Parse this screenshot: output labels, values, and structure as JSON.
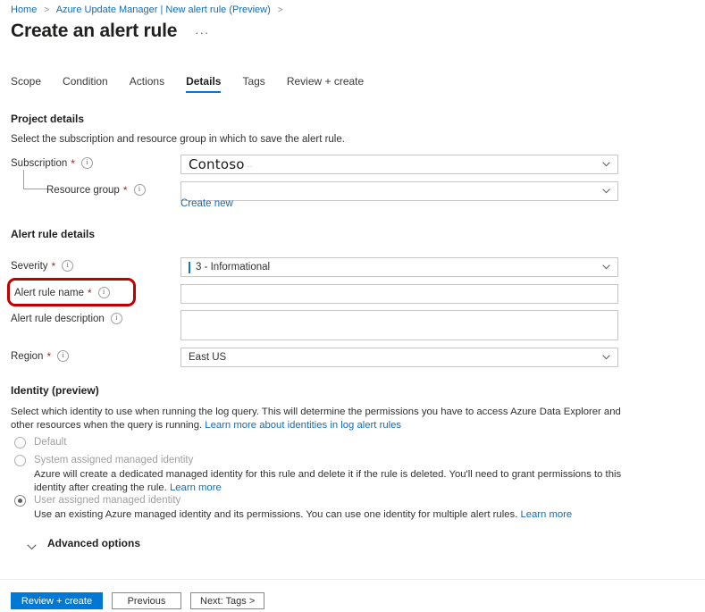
{
  "breadcrumb": {
    "items": [
      "Home",
      "Azure Update Manager | New alert rule (Preview)"
    ],
    "separator": ">",
    "trailing_separator": ">"
  },
  "header": {
    "title": "Create an alert rule",
    "more_menu": "···"
  },
  "tabs": [
    {
      "label": "Scope",
      "active": false
    },
    {
      "label": "Condition",
      "active": false
    },
    {
      "label": "Actions",
      "active": false
    },
    {
      "label": "Details",
      "active": true
    },
    {
      "label": "Tags",
      "active": false
    },
    {
      "label": "Review + create",
      "active": false
    }
  ],
  "project_details": {
    "heading": "Project details",
    "description": "Select the subscription and resource group in which to save the alert rule.",
    "subscription": {
      "label": "Subscription",
      "required_marker": "*",
      "value": "Contoso",
      "value_suffix": ".."
    },
    "resource_group": {
      "label": "Resource group",
      "required_marker": "*",
      "value": "",
      "create_new_link": "Create new"
    }
  },
  "alert_rule_details": {
    "heading": "Alert rule details",
    "severity": {
      "label": "Severity",
      "required_marker": "*",
      "value": "3 - Informational",
      "indicator_color": "#0078d4"
    },
    "alert_rule_name": {
      "label": "Alert rule name",
      "required_marker": "*",
      "value": "",
      "highlighted": true,
      "highlight_color": "#c00000"
    },
    "alert_rule_description": {
      "label": "Alert rule description",
      "required_marker": "",
      "value": ""
    },
    "region": {
      "label": "Region",
      "required_marker": "*",
      "value": "East US"
    }
  },
  "identity": {
    "heading": "Identity (preview)",
    "description_part1": "Select which identity to use when running the log query. This will determine the permissions you have to access Azure Data Explorer and other resources when the query is running. ",
    "description_link": "Learn more about identities in log alert rules",
    "options": [
      {
        "label": "Default",
        "selected": false,
        "description": "",
        "link": ""
      },
      {
        "label": "System assigned managed identity",
        "selected": false,
        "description": "Azure will create a dedicated managed identity for this rule and delete it if the rule is deleted. You'll need to grant permissions to this identity after creating the rule. ",
        "link": "Learn more"
      },
      {
        "label": "User assigned managed identity",
        "selected": true,
        "description": "Use an existing Azure managed identity and its permissions. You can use one identity for multiple alert rules. ",
        "link": "Learn more"
      }
    ]
  },
  "advanced_options": {
    "label": "Advanced options",
    "expanded": false
  },
  "footer": {
    "primary_button": "Review + create",
    "previous_button": "Previous",
    "next_button": "Next: Tags >"
  },
  "colors": {
    "accent": "#0078d4",
    "link": "#0f6cbd",
    "required": "#a4262c",
    "annotation": "#c00000"
  }
}
